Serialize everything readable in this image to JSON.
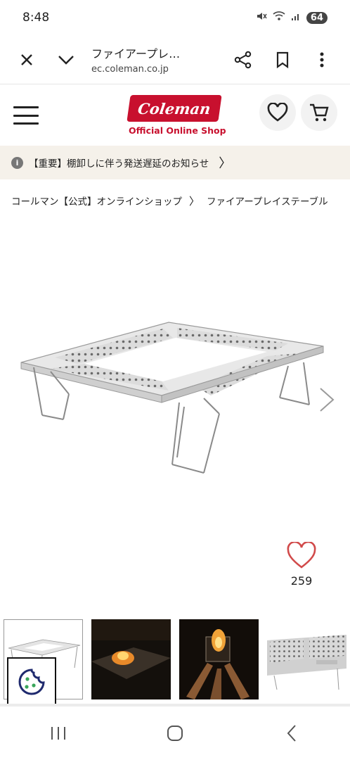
{
  "status_bar": {
    "time": "8:48",
    "battery": "64"
  },
  "browser": {
    "page_title": "ファイアープレ…",
    "url": "ec.coleman.co.jp"
  },
  "header": {
    "logo_text": "Coleman",
    "logo_subtitle": "Official Online Shop"
  },
  "notice": {
    "icon_text": "i",
    "text": "【重要】棚卸しに伴う発送遅延のお知らせ",
    "chevron": "〉"
  },
  "breadcrumb": {
    "home": "コールマン【公式】オンラインショップ",
    "separator": "〉",
    "current": "ファイアープレイステーブル"
  },
  "product": {
    "favorite_count": "259"
  },
  "thumbnails": [
    {
      "name": "thumb-table-overview"
    },
    {
      "name": "thumb-fire-night"
    },
    {
      "name": "thumb-fire-closeup"
    },
    {
      "name": "thumb-table-detail"
    }
  ],
  "colors": {
    "brand_red": "#c8102e",
    "notice_bg": "#f5f1ea",
    "heart": "#d14a4a"
  }
}
